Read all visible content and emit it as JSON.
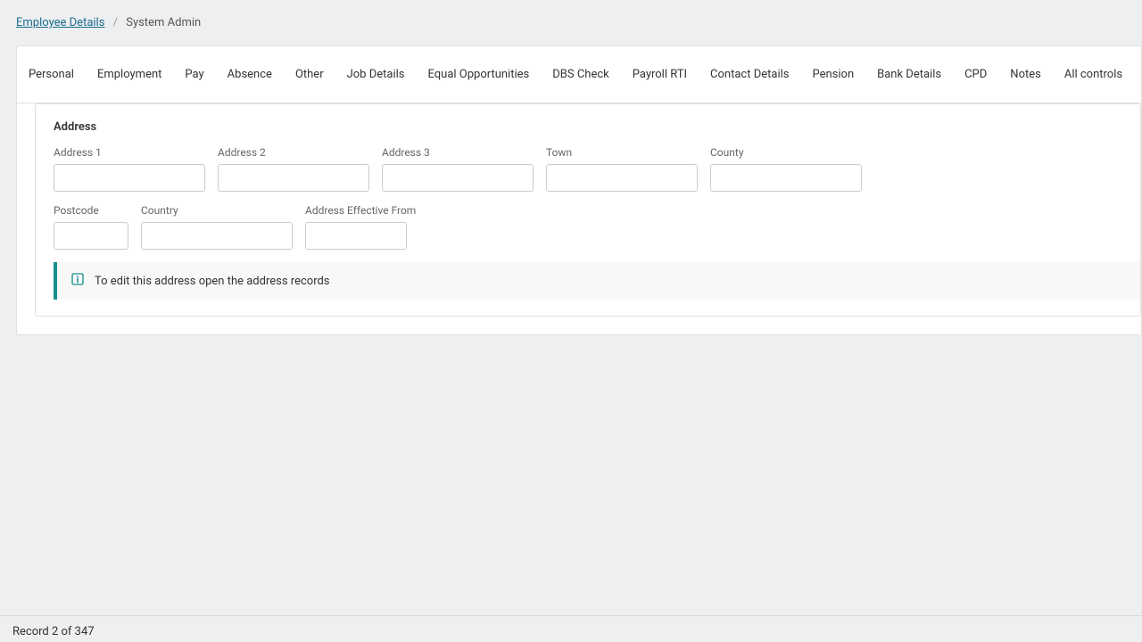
{
  "breadcrumb": {
    "parent_label": "Employee Details",
    "current_label": "System Admin",
    "separator": "/"
  },
  "tabs": {
    "items": [
      "Personal",
      "Employment",
      "Pay",
      "Absence",
      "Other",
      "Job Details",
      "Equal Opportunities",
      "DBS Check",
      "Payroll RTI",
      "Contact Details",
      "Pension",
      "Bank Details",
      "CPD",
      "Notes",
      "All controls"
    ]
  },
  "address": {
    "section_title": "Address",
    "fields": {
      "address1": {
        "label": "Address 1",
        "value": ""
      },
      "address2": {
        "label": "Address 2",
        "value": ""
      },
      "address3": {
        "label": "Address 3",
        "value": ""
      },
      "town": {
        "label": "Town",
        "value": ""
      },
      "county": {
        "label": "County",
        "value": ""
      },
      "postcode": {
        "label": "Postcode",
        "value": ""
      },
      "country": {
        "label": "Country",
        "value": ""
      },
      "effective_from": {
        "label": "Address Effective From",
        "value": ""
      }
    },
    "info_message": "To edit this address open the address records"
  },
  "footer": {
    "record_status": "Record 2 of 347"
  }
}
